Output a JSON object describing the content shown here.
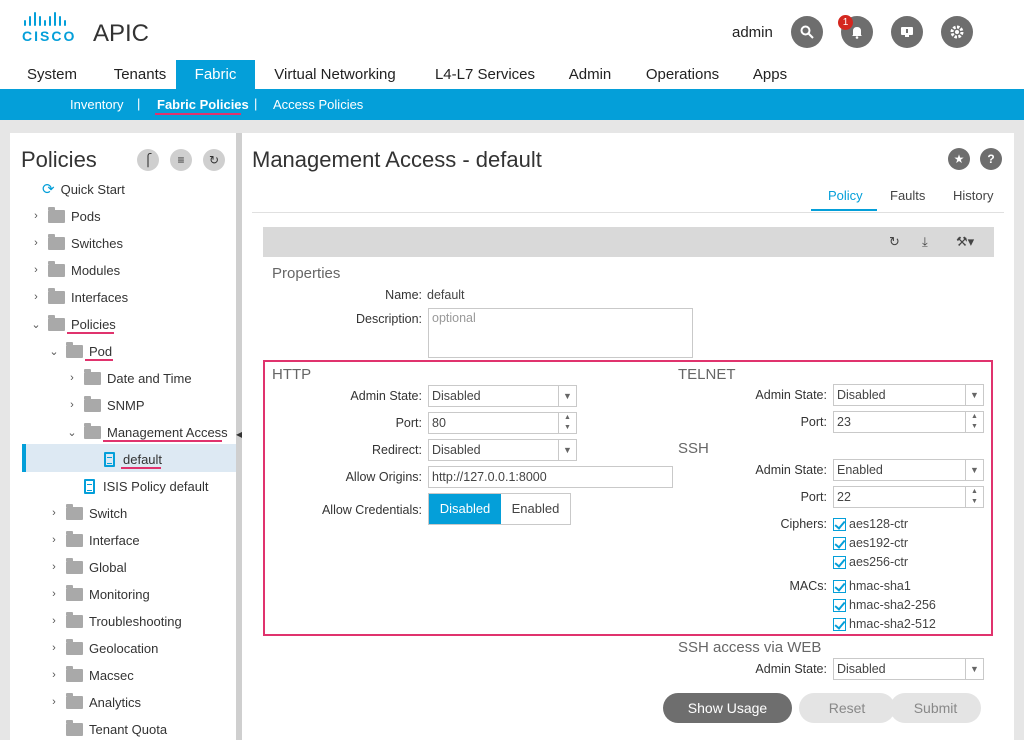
{
  "app": {
    "logo_text": "CISCO",
    "title": "APIC",
    "user": "admin",
    "notification_count": "1"
  },
  "header_icons": {
    "search": "search-icon",
    "alerts": "bell-icon",
    "screen": "monitor-icon",
    "settings": "gear-icon"
  },
  "main_nav": [
    {
      "label": "System",
      "active": false
    },
    {
      "label": "Tenants",
      "active": false
    },
    {
      "label": "Fabric",
      "active": true
    },
    {
      "label": "Virtual Networking",
      "active": false
    },
    {
      "label": "L4-L7 Services",
      "active": false
    },
    {
      "label": "Admin",
      "active": false
    },
    {
      "label": "Operations",
      "active": false
    },
    {
      "label": "Apps",
      "active": false
    }
  ],
  "sub_nav": [
    {
      "label": "Inventory",
      "active": false
    },
    {
      "label": "Fabric Policies",
      "active": true
    },
    {
      "label": "Access Policies",
      "active": false
    }
  ],
  "left_panel": {
    "title": "Policies",
    "tree": [
      {
        "label": "Quick Start",
        "type": "quickstart"
      },
      {
        "label": "Pods",
        "type": "folder",
        "expanded": false
      },
      {
        "label": "Switches",
        "type": "folder",
        "expanded": false
      },
      {
        "label": "Modules",
        "type": "folder",
        "expanded": false
      },
      {
        "label": "Interfaces",
        "type": "folder",
        "expanded": false
      },
      {
        "label": "Policies",
        "type": "folder",
        "expanded": true
      },
      {
        "label": "Pod",
        "type": "folder",
        "expanded": true
      },
      {
        "label": "Date and Time",
        "type": "folder",
        "expanded": false
      },
      {
        "label": "SNMP",
        "type": "folder",
        "expanded": false
      },
      {
        "label": "Management Access",
        "type": "folder",
        "expanded": true
      },
      {
        "label": "default",
        "type": "doc",
        "selected": true
      },
      {
        "label": "ISIS Policy default",
        "type": "doc"
      },
      {
        "label": "Switch",
        "type": "folder",
        "expanded": false
      },
      {
        "label": "Interface",
        "type": "folder",
        "expanded": false
      },
      {
        "label": "Global",
        "type": "folder",
        "expanded": false
      },
      {
        "label": "Monitoring",
        "type": "folder",
        "expanded": false
      },
      {
        "label": "Troubleshooting",
        "type": "folder",
        "expanded": false
      },
      {
        "label": "Geolocation",
        "type": "folder",
        "expanded": false
      },
      {
        "label": "Macsec",
        "type": "folder",
        "expanded": false
      },
      {
        "label": "Analytics",
        "type": "folder",
        "expanded": false
      },
      {
        "label": "Tenant Quota",
        "type": "folder"
      }
    ]
  },
  "main": {
    "title": "Management Access - default",
    "tabs": [
      {
        "label": "Policy",
        "active": true
      },
      {
        "label": "Faults",
        "active": false
      },
      {
        "label": "History",
        "active": false
      }
    ],
    "properties": {
      "heading": "Properties",
      "name_label": "Name:",
      "name_value": "default",
      "description_label": "Description:",
      "description_placeholder": "optional"
    },
    "http": {
      "heading": "HTTP",
      "admin_state_label": "Admin State:",
      "admin_state": "Disabled",
      "port_label": "Port:",
      "port": "80",
      "redirect_label": "Redirect:",
      "redirect": "Disabled",
      "allow_origins_label": "Allow Origins:",
      "allow_origins": "http://127.0.0.1:8000",
      "allow_credentials_label": "Allow Credentials:",
      "allow_credentials_options": [
        "Disabled",
        "Enabled"
      ],
      "allow_credentials_selected": "Disabled"
    },
    "telnet": {
      "heading": "TELNET",
      "admin_state_label": "Admin State:",
      "admin_state": "Disabled",
      "port_label": "Port:",
      "port": "23"
    },
    "ssh": {
      "heading": "SSH",
      "admin_state_label": "Admin State:",
      "admin_state": "Enabled",
      "port_label": "Port:",
      "port": "22",
      "ciphers_label": "Ciphers:",
      "ciphers": [
        "aes128-ctr",
        "aes192-ctr",
        "aes256-ctr"
      ],
      "macs_label": "MACs:",
      "macs": [
        "hmac-sha1",
        "hmac-sha2-256",
        "hmac-sha2-512"
      ]
    },
    "ssh_web": {
      "heading": "SSH access via WEB",
      "admin_state_label": "Admin State:",
      "admin_state": "Disabled"
    },
    "buttons": {
      "show_usage": "Show Usage",
      "reset": "Reset",
      "submit": "Submit"
    }
  },
  "colors": {
    "accent": "#049fd9",
    "highlight": "#e0336d",
    "badge": "#d4271f"
  }
}
